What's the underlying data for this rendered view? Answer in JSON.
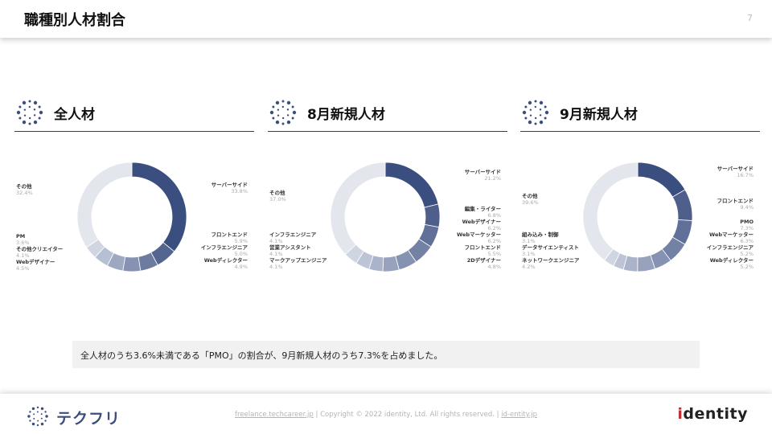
{
  "header": {
    "title": "職種別人材割合",
    "page_number": "7"
  },
  "panels": [
    {
      "title": "全人材",
      "labels": [
        {
          "name": "サーバーサイド",
          "value": "33.8%"
        },
        {
          "name": "フロントエンド",
          "value": "5.9%"
        },
        {
          "name": "インフラエンジニア",
          "value": "5.0%"
        },
        {
          "name": "Webディレクター",
          "value": "4.9%"
        },
        {
          "name": "その他",
          "value": "32.4%"
        },
        {
          "name": "PM",
          "value": "3.6%"
        },
        {
          "name": "その他クリエイター",
          "value": "4.1%"
        },
        {
          "name": "Webデザイナー",
          "value": "4.5%"
        }
      ]
    },
    {
      "title": "8月新規人材",
      "labels": [
        {
          "name": "サーバーサイド",
          "value": "21.2%"
        },
        {
          "name": "編集・ライター",
          "value": "6.8%"
        },
        {
          "name": "Webデザイナー",
          "value": "6.2%"
        },
        {
          "name": "Webマーケッター",
          "value": "6.2%"
        },
        {
          "name": "フロントエンド",
          "value": "5.5%"
        },
        {
          "name": "2Dデザイナー",
          "value": "4.8%"
        },
        {
          "name": "その他",
          "value": "37.0%"
        },
        {
          "name": "インフラエンジニア",
          "value": "4.1%"
        },
        {
          "name": "営業アシスタント",
          "value": "4.1%"
        },
        {
          "name": "マークアップエンジニア",
          "value": "4.1%"
        }
      ]
    },
    {
      "title": "9月新規人材",
      "labels": [
        {
          "name": "サーバーサイド",
          "value": "16.7%"
        },
        {
          "name": "フロントエンド",
          "value": "9.4%"
        },
        {
          "name": "PMO",
          "value": "7.3%"
        },
        {
          "name": "Webマーケッター",
          "value": "6.3%"
        },
        {
          "name": "インフラエンジニア",
          "value": "5.2%"
        },
        {
          "name": "Webディレクター",
          "value": "5.2%"
        },
        {
          "name": "その他",
          "value": "39.6%"
        },
        {
          "name": "組み込み・制御",
          "value": "3.1%"
        },
        {
          "name": "データサイエンティスト",
          "value": "3.1%"
        },
        {
          "name": "ネットワークエンジニア",
          "value": "4.2%"
        }
      ]
    }
  ],
  "note": "全人材のうち3.6%未満である「PMO」の割合が、9月新規人材のうち7.3%を占めました。",
  "footer": {
    "brand": "テクフリ",
    "link1": "freelance.techcareer.jp",
    "copyright": "Copyright © 2022 identity, Ltd. All rights reserved.",
    "link2": "id-entity.jp",
    "sep": "|",
    "company_logo": "identity"
  },
  "colors": {
    "accent": "#3b4f7c",
    "navy": "#2c3e66",
    "other_slice": "#e3e6ec"
  },
  "chart_data": [
    {
      "type": "pie",
      "title": "全人材",
      "categories": [
        "サーバーサイド",
        "フロントエンド",
        "インフラエンジニア",
        "Webディレクター",
        "Webデザイナー",
        "その他クリエイター",
        "PM",
        "その他"
      ],
      "values": [
        33.8,
        5.9,
        5.0,
        4.9,
        4.5,
        4.1,
        3.6,
        32.4
      ]
    },
    {
      "type": "pie",
      "title": "8月新規人材",
      "categories": [
        "サーバーサイド",
        "編集・ライター",
        "Webデザイナー",
        "Webマーケッター",
        "フロントエンド",
        "2Dデザイナー",
        "マークアップエンジニア",
        "営業アシスタント",
        "インフラエンジニア",
        "その他"
      ],
      "values": [
        21.2,
        6.8,
        6.2,
        6.2,
        5.5,
        4.8,
        4.1,
        4.1,
        4.1,
        37.0
      ]
    },
    {
      "type": "pie",
      "title": "9月新規人材",
      "categories": [
        "サーバーサイド",
        "フロントエンド",
        "PMO",
        "Webマーケッター",
        "インフラエンジニア",
        "Webディレクター",
        "ネットワークエンジニア",
        "データサイエンティスト",
        "組み込み・制御",
        "その他"
      ],
      "values": [
        16.7,
        9.4,
        7.3,
        6.3,
        5.2,
        5.2,
        4.2,
        3.1,
        3.1,
        39.6
      ]
    }
  ]
}
